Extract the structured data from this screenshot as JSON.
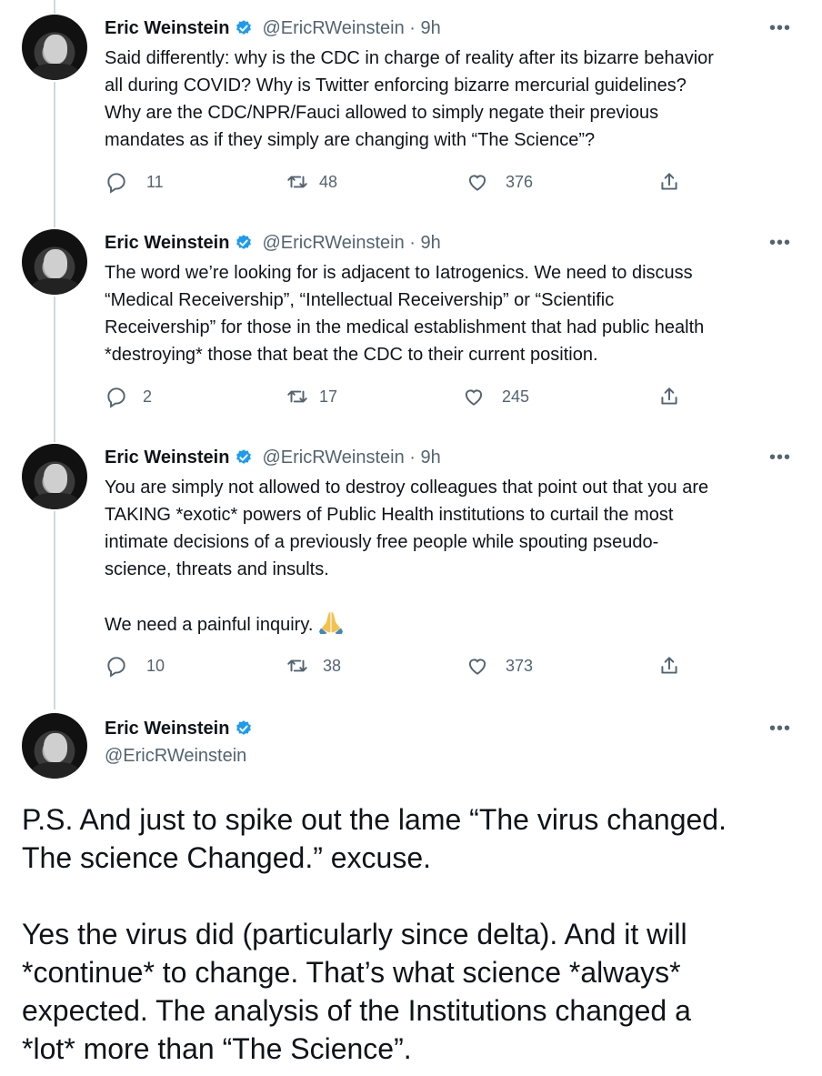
{
  "author": {
    "name": "Eric Weinstein",
    "handle": "@EricRWeinstein"
  },
  "icons": {
    "avatar": "profile-photo",
    "verified": "verified-badge-icon",
    "more": "more-options-icon",
    "reply": "reply-icon",
    "retweet": "retweet-icon",
    "like": "heart-icon",
    "share": "share-icon",
    "emoji": "folded-hands-emoji"
  },
  "colors": {
    "verified_blue": "#1d9bf0",
    "secondary_text": "#536471",
    "thread_line": "#cfd9de"
  },
  "tweets": [
    {
      "meta": "@EricRWeinstein · 9h",
      "more": "•••",
      "lines": [
        "Said differently: why is the CDC in charge of reality after its bizarre behavior",
        "all during COVID? Why is Twitter enforcing bizarre mercurial guidelines?",
        "Why are the CDC/NPR/Fauci allowed to simply negate their previous",
        "mandates as if they simply are changing with “The Science”?"
      ],
      "replies": "11",
      "retweets": "48",
      "likes": "376"
    },
    {
      "meta": "@EricRWeinstein · 9h",
      "more": "•••",
      "lines": [
        "The word we’re looking for is adjacent to Iatrogenics. We need to discuss",
        "“Medical Receivership”, “Intellectual Receivership” or “Scientific",
        "Receivership” for those in the medical establishment that had public health",
        "*destroying* those that beat the CDC to their current position."
      ],
      "replies": "2",
      "retweets": "17",
      "likes": "245"
    },
    {
      "meta": "@EricRWeinstein · 9h",
      "more": "•••",
      "lines": [
        "You are simply not allowed to destroy colleagues that point out that you are",
        "TAKING *exotic* powers of Public Health institutions to curtail the most",
        "intimate decisions of a previously free people while spouting pseudo-",
        "science, threats and insults."
      ],
      "last_line": "We need a painful inquiry.",
      "replies": "10",
      "retweets": "38",
      "likes": "373"
    }
  ],
  "main_tweet": {
    "name": "Eric Weinstein",
    "handle": "@EricRWeinstein",
    "more": "•••",
    "lines": [
      "P.S. And just to spike out the lame “The virus changed.",
      "The science Changed.” excuse."
    ],
    "lines2": [
      "Yes the virus did (particularly since delta). And it will",
      "*continue* to change. That’s what science *always*",
      "expected. The analysis of the Institutions changed a",
      "*lot* more than “The Science”."
    ]
  }
}
